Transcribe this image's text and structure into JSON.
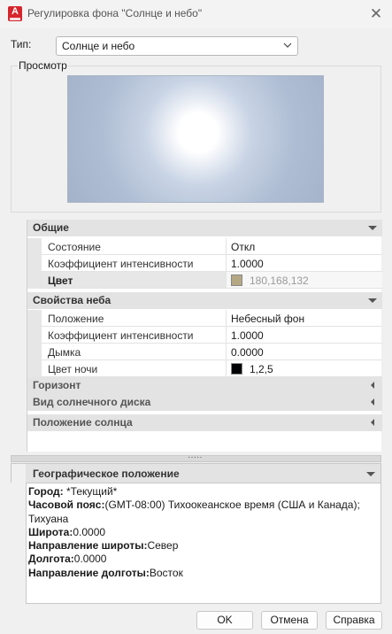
{
  "window": {
    "title": "Регулировка фона \"Солнце и небо\"",
    "app_icon_letter": "A"
  },
  "type": {
    "label": "Тип:",
    "value": "Солнце и небо"
  },
  "preview": {
    "label": "Просмотр"
  },
  "sections": {
    "general": {
      "title": "Общие",
      "rows": [
        {
          "name": "Состояние",
          "value": "Откл"
        },
        {
          "name": "Коэффициент интенсивности",
          "value": "1.0000"
        },
        {
          "name": "Цвет",
          "value": "180,168,132",
          "swatch": "#b4a884"
        }
      ]
    },
    "sky": {
      "title": "Свойства неба",
      "rows": [
        {
          "name": "Положение",
          "value": "Небесный фон"
        },
        {
          "name": "Коэффициент интенсивности",
          "value": "1.0000"
        },
        {
          "name": "Дымка",
          "value": "0.0000"
        },
        {
          "name": "Цвет ночи",
          "value": "1,2,5",
          "swatch": "#010205"
        }
      ]
    },
    "horizon": {
      "title": "Горизонт"
    },
    "sun_disk": {
      "title": "Вид солнечного диска"
    },
    "sun_position": {
      "title": "Положение солнца"
    }
  },
  "splitter": "·····",
  "geo": {
    "title": "Географическое положение",
    "city_label": "Город:",
    "city_value": " *Текущий*",
    "tz_label": "Часовой пояс:",
    "tz_value": "(GMT-08:00) Тихоокеанское время (США и Канада);",
    "tz_value2": "Тихуана",
    "lat_label": "Широта:",
    "lat_value": "0.0000",
    "lat_dir_label": "Направление широты:",
    "lat_dir_value": "Север",
    "lon_label": "Долгота:",
    "lon_value": "0.0000",
    "lon_dir_label": "Направление долготы:",
    "lon_dir_value": "Восток"
  },
  "buttons": {
    "ok": "OK",
    "cancel": "Отмена",
    "help": "Справка"
  }
}
